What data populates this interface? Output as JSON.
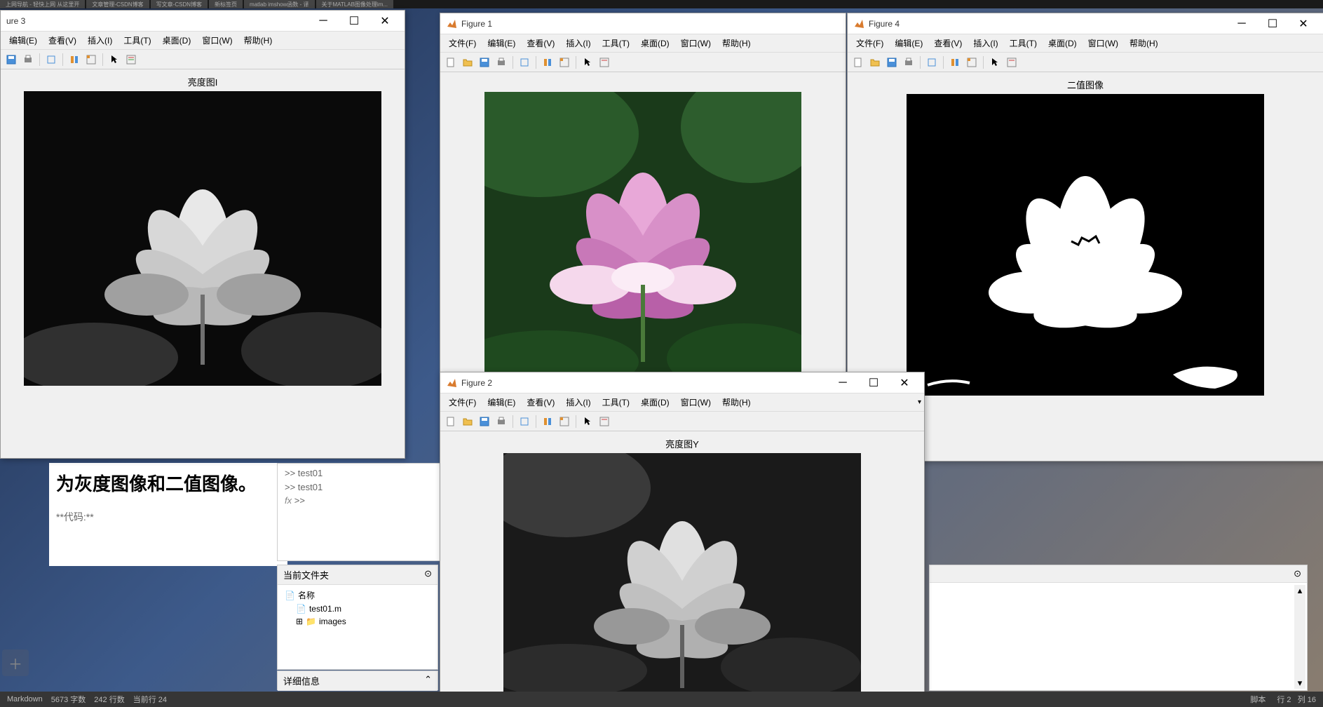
{
  "taskbar": {
    "tabs": [
      "上网导航 - 轻快上网 从这里开",
      "文章管理-CSDN博客",
      "写文章-CSDN博客",
      "新标签页",
      "matlab imshow函数 - 译",
      "关于MATLAB图像处理im..."
    ]
  },
  "menus": {
    "file": "文件(F)",
    "edit": "编辑(E)",
    "view": "查看(V)",
    "insert": "插入(I)",
    "tools": "工具(T)",
    "desktop": "桌面(D)",
    "window": "窗口(W)",
    "help": "帮助(H)"
  },
  "figures": {
    "fig1": {
      "title": "Figure 1",
      "image_title": ""
    },
    "fig2": {
      "title": "Figure 2",
      "image_title": "亮度图Y"
    },
    "fig3": {
      "title": "ure 3",
      "image_title": "亮度图I"
    },
    "fig4": {
      "title": "Figure 4",
      "image_title": "二值图像"
    }
  },
  "toolbar_icons": [
    "new-file",
    "open-file",
    "save",
    "print",
    "datacursor",
    "rotate",
    "pan",
    "zoom-in",
    "pointer",
    "insert-legend"
  ],
  "doc": {
    "heading": "为灰度图像和二值图像。",
    "code_label": "**代码:**"
  },
  "command_window": {
    "lines": [
      ">> test01",
      ">> test01",
      ">>"
    ],
    "fx_label": "fx"
  },
  "current_folder": {
    "title": "当前文件夹",
    "header": "名称",
    "files": [
      "test01.m",
      "images"
    ]
  },
  "details": {
    "title": "详细信息"
  },
  "workspace": {
    "title": ""
  },
  "status": {
    "format": "Markdown",
    "chars": "5673 字数",
    "lines": "242 行数",
    "current": "当前行 24",
    "script_label": "脚本",
    "row_label": "行",
    "row_value": "2",
    "col_label": "列",
    "col_value": "16"
  }
}
